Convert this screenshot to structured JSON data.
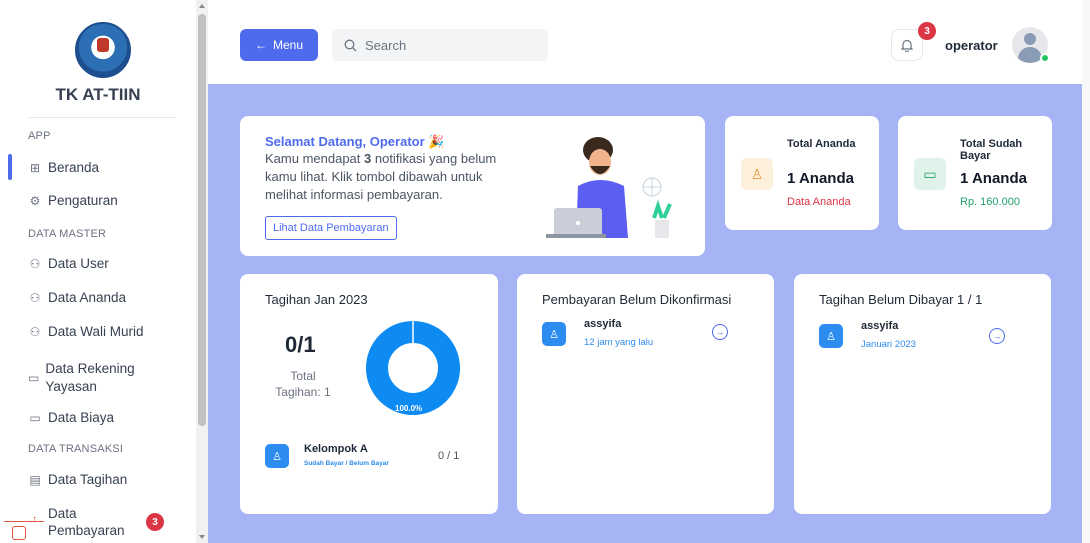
{
  "sidebar": {
    "brand": "TK AT-TIIN",
    "sections": {
      "app": "APP",
      "master": "DATA MASTER",
      "transaksi": "DATA TRANSAKSI"
    },
    "items": [
      {
        "label": "Beranda",
        "icon": "grid-icon",
        "active": true
      },
      {
        "label": "Pengaturan",
        "icon": "gear-icon"
      },
      {
        "label": "Data User",
        "icon": "users-icon"
      },
      {
        "label": "Data Ananda",
        "icon": "users-icon"
      },
      {
        "label": "Data Wali Murid",
        "icon": "users-icon"
      },
      {
        "label": "Data Rekening Yayasan",
        "icon": "card-icon"
      },
      {
        "label": "Data Biaya",
        "icon": "card-icon"
      },
      {
        "label": "Data Tagihan",
        "icon": "calendar-icon"
      },
      {
        "label": "Data Pembayaran",
        "icon": "wallet-icon",
        "badge": "3"
      }
    ]
  },
  "header": {
    "menu_label": "Menu",
    "search_placeholder": "Search",
    "notif_count": "3",
    "username": "operator"
  },
  "welcome": {
    "title": "Selamat Datang, Operator",
    "line_prefix": "Kamu mendapat ",
    "count": "3",
    "line_rest": " notifikasi yang belum kamu lihat. Klik tombol dibawah untuk melihat informasi pembayaran.",
    "button": "Lihat Data Pembayaran"
  },
  "stats": [
    {
      "label": "Total Ananda",
      "value": "1 Ananda",
      "sub": "Data Ananda",
      "color": "#e89a3c"
    },
    {
      "label": "Total Sudah Bayar",
      "value": "1 Ananda",
      "sub": "Rp. 160.000",
      "color": "#22a06b"
    }
  ],
  "tagihan": {
    "title": "Tagihan Jan 2023",
    "fraction": "0/1",
    "total_label": "Total Tagihan: 1",
    "percent_label": "100.0%",
    "percent": 1.0,
    "group": {
      "name": "Kelompok A",
      "sub": "Sudah Bayar / Belum Bayar",
      "value": "0 / 1"
    }
  },
  "belum_konfirmasi": {
    "title": "Pembayaran Belum Dikonfirmasi",
    "items": [
      {
        "name": "assyifa",
        "sub": "12 jam yang lalu"
      }
    ]
  },
  "belum_dibayar": {
    "title": "Tagihan Belum Dibayar 1 / 1",
    "items": [
      {
        "name": "assyifa",
        "sub": "Januari 2023"
      }
    ]
  },
  "colors": {
    "accent": "#4f6bed",
    "background": "#a6b3f5",
    "donut": "#0d8bf2",
    "danger": "#dc3545"
  }
}
